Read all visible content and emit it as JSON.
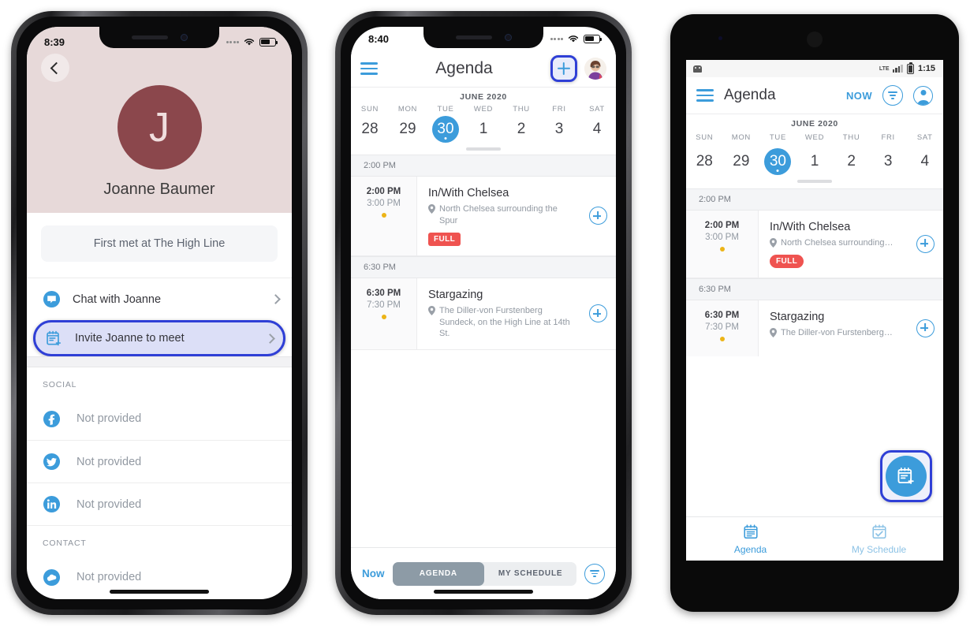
{
  "phone1": {
    "status_bar": {
      "time": "8:39"
    },
    "back_label": "back",
    "profile": {
      "avatar_initial": "J",
      "name": "Joanne Baumer",
      "met_note": "First met at The High Line",
      "avatar_color": "#8b474c",
      "hero_bg": "#e7d9d9"
    },
    "actions": [
      {
        "label": "Chat with Joanne",
        "icon": "chat-bubble-icon",
        "highlighted": false
      },
      {
        "label": "Invite Joanne to meet",
        "icon": "calendar-add-icon",
        "highlighted": true
      }
    ],
    "sections": [
      {
        "heading": "SOCIAL",
        "rows": [
          {
            "icon": "facebook-icon",
            "value": "Not provided"
          },
          {
            "icon": "twitter-icon",
            "value": "Not provided"
          },
          {
            "icon": "linkedin-icon",
            "value": "Not provided"
          }
        ]
      },
      {
        "heading": "CONTACT",
        "rows": [
          {
            "icon": "cloud-icon",
            "value": "Not provided"
          }
        ]
      }
    ]
  },
  "phone2": {
    "status_bar": {
      "time": "8:40"
    },
    "header": {
      "menu_icon": "hamburger-menu-icon",
      "title": "Agenda",
      "add_icon": "plus-icon",
      "avatar_icon": "user-avatar-icon"
    },
    "calendar": {
      "month": "JUNE 2020",
      "days": [
        {
          "dow": "SUN",
          "date": "28",
          "selected": false
        },
        {
          "dow": "MON",
          "date": "29",
          "selected": false
        },
        {
          "dow": "TUE",
          "date": "30",
          "selected": true
        },
        {
          "dow": "WED",
          "date": "1",
          "selected": false
        },
        {
          "dow": "THU",
          "date": "2",
          "selected": false
        },
        {
          "dow": "FRI",
          "date": "3",
          "selected": false
        },
        {
          "dow": "SAT",
          "date": "4",
          "selected": false
        }
      ]
    },
    "agenda": [
      {
        "band": "2:00 PM",
        "start": "2:00 PM",
        "end": "3:00 PM",
        "title": "In/With Chelsea",
        "location": "North Chelsea surrounding the Spur",
        "badge": "FULL"
      },
      {
        "band": "6:30 PM",
        "start": "6:30 PM",
        "end": "7:30 PM",
        "title": "Stargazing",
        "location": "The Diller-von Furstenberg Sundeck, on the High Line at 14th St.",
        "badge": ""
      }
    ],
    "bottom": {
      "now": "Now",
      "tab_agenda": "AGENDA",
      "tab_my_schedule": "MY SCHEDULE",
      "filter_icon": "filter-icon"
    }
  },
  "phone3": {
    "status_bar": {
      "time": "1:15",
      "network": "LTE"
    },
    "header": {
      "menu_icon": "hamburger-menu-icon",
      "title": "Agenda",
      "now": "NOW",
      "filter_icon": "filter-icon",
      "account_icon": "account-circle-icon"
    },
    "calendar": {
      "month": "JUNE 2020",
      "days": [
        {
          "dow": "SUN",
          "date": "28",
          "selected": false
        },
        {
          "dow": "MON",
          "date": "29",
          "selected": false
        },
        {
          "dow": "TUE",
          "date": "30",
          "selected": true
        },
        {
          "dow": "WED",
          "date": "1",
          "selected": false
        },
        {
          "dow": "THU",
          "date": "2",
          "selected": false
        },
        {
          "dow": "FRI",
          "date": "3",
          "selected": false
        },
        {
          "dow": "SAT",
          "date": "4",
          "selected": false
        }
      ]
    },
    "agenda": [
      {
        "band": "2:00 PM",
        "start": "2:00 PM",
        "end": "3:00 PM",
        "title": "In/With Chelsea",
        "location": "North Chelsea surrounding…",
        "badge": "FULL"
      },
      {
        "band": "6:30 PM",
        "start": "6:30 PM",
        "end": "7:30 PM",
        "title": "Stargazing",
        "location": "The Diller-von Furstenberg…",
        "badge": ""
      }
    ],
    "fab": {
      "icon": "calendar-add-icon",
      "highlighted": true
    },
    "tabs": [
      {
        "label": "Agenda",
        "icon": "agenda-icon",
        "active": true
      },
      {
        "label": "My Schedule",
        "icon": "schedule-check-icon",
        "active": false
      }
    ]
  },
  "colors": {
    "accent_blue": "#3c9cdb",
    "highlight_ring": "#2f3fd6",
    "badge_red": "#ef5350",
    "dot_yellow": "#ecb417"
  }
}
